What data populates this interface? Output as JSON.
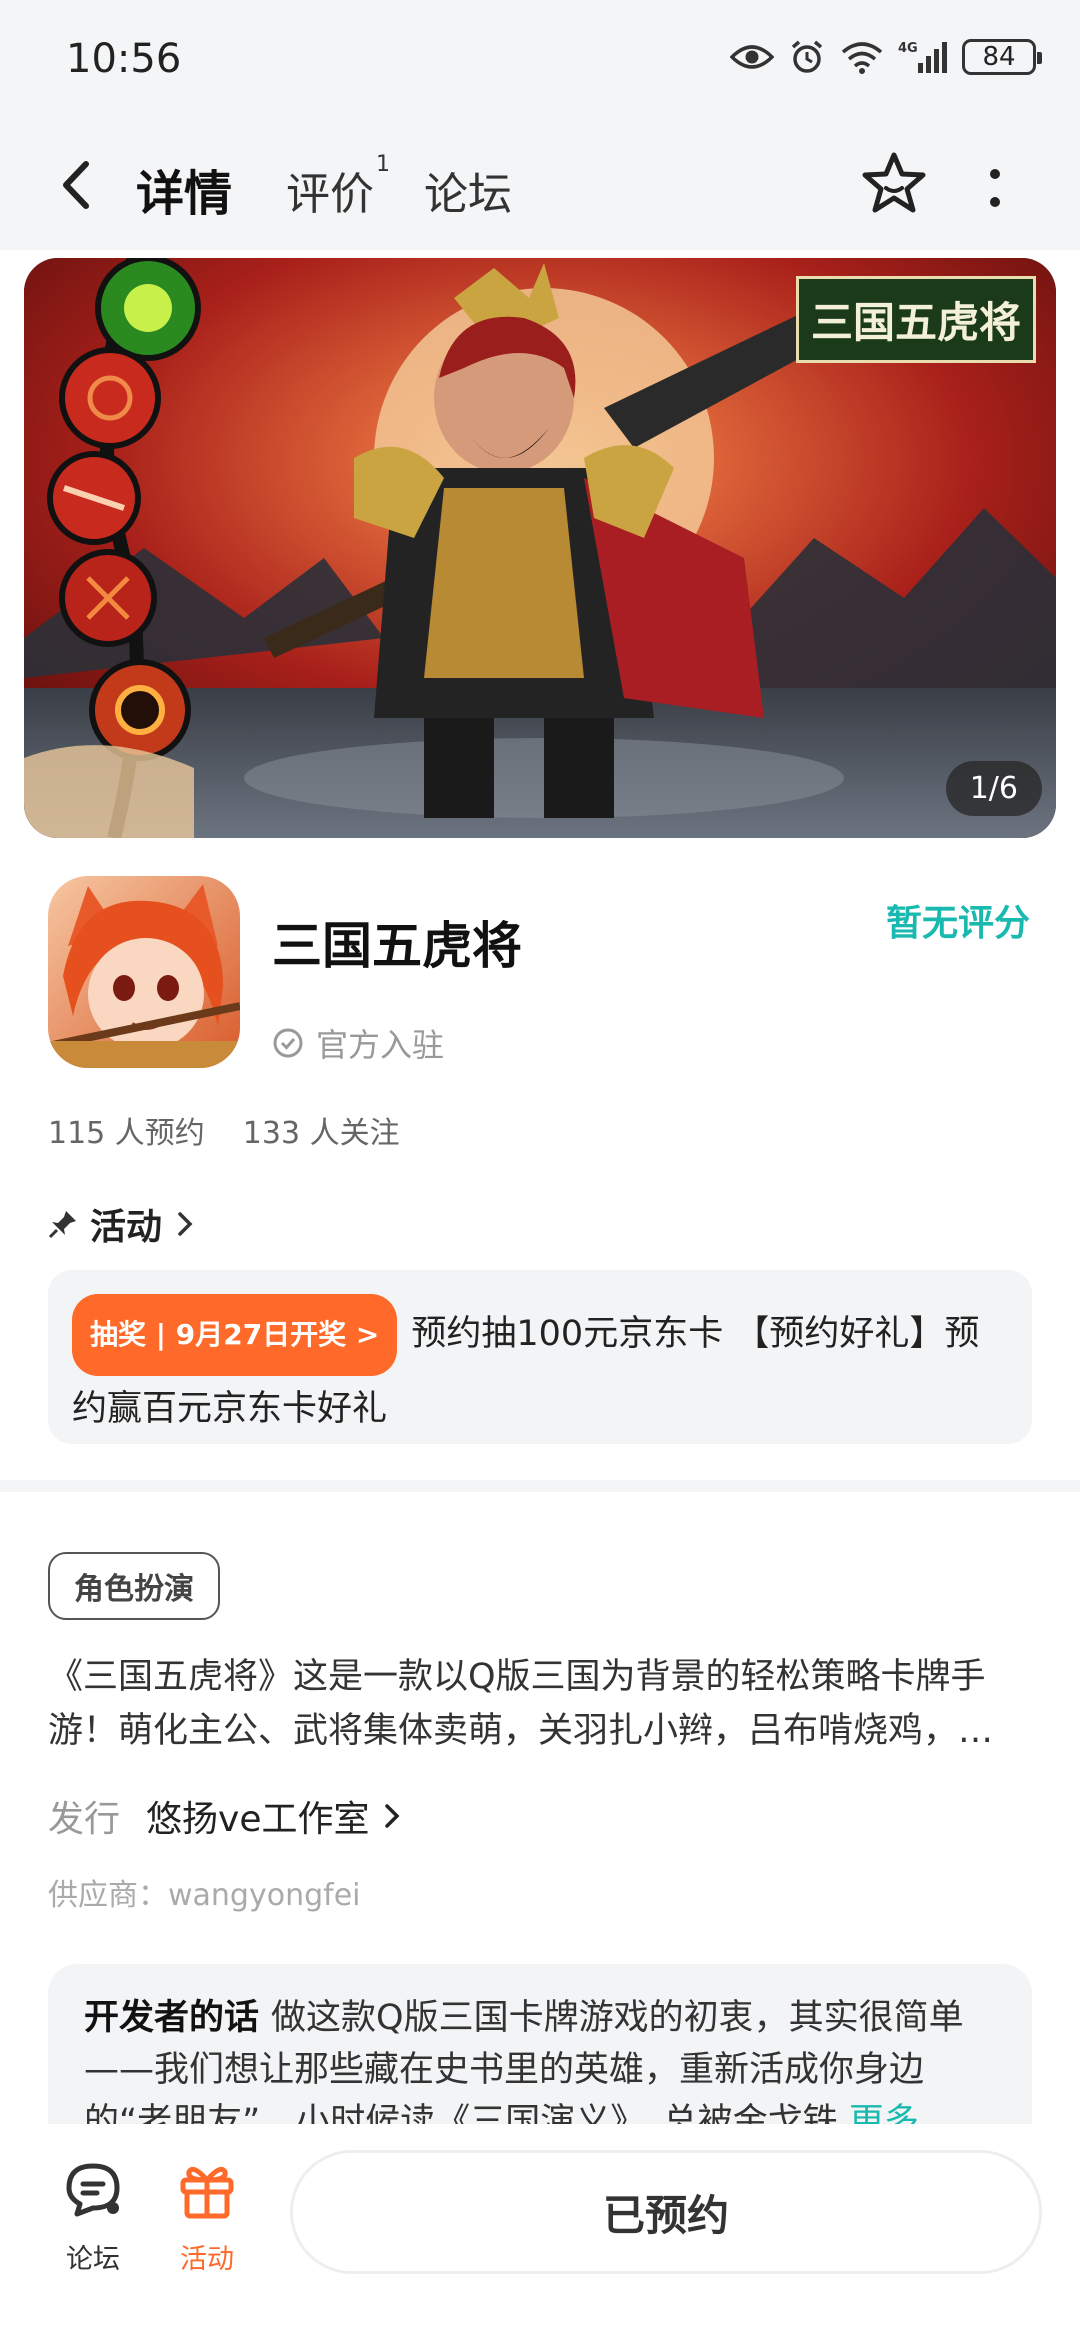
{
  "status_bar": {
    "time": "10:56",
    "battery": "84",
    "network": "4G"
  },
  "nav": {
    "tabs": [
      {
        "label": "详情",
        "active": true
      },
      {
        "label": "评价",
        "count": "1"
      },
      {
        "label": "论坛"
      }
    ]
  },
  "hero": {
    "counter": "1/6",
    "logo_text": "三国五虎将"
  },
  "app": {
    "name": "三国五虎将",
    "rating": "暂无评分",
    "official": "官方入驻",
    "reservations": "115 人预约",
    "followers": "133 人关注"
  },
  "activity": {
    "heading": "活动",
    "badge": "抽奖 | 9月27日开奖 >",
    "text": "预约抽100元京东卡 【预约好礼】预约赢百元京东卡好礼"
  },
  "details": {
    "genre_tag": "角色扮演",
    "description": "《三国五虎将》这是一款以Q版三国为背景的轻松策略卡牌手游！萌化主公、武将集体卖萌，关羽扎小辫，吕布啃烧鸡，…",
    "publisher_label": "发行",
    "publisher_name": "悠扬ve工作室",
    "supplier": "供应商：wangyongfei"
  },
  "developer_note": {
    "title": "开发者的话",
    "text": "做这款Q版三国卡牌游戏的初衷，其实很简单——我们想让那些藏在史书里的英雄，重新活成你身边的“老朋友”。小时候读《三国演义》，总被金戈铁",
    "more": "更多"
  },
  "bottom_bar": {
    "forum_label": "论坛",
    "activity_label": "活动",
    "reserve_label": "已预约"
  },
  "colors": {
    "accent": "#1ab9b0",
    "tab_underline": "#1dd1c5",
    "orange": "#ff6a2a"
  }
}
